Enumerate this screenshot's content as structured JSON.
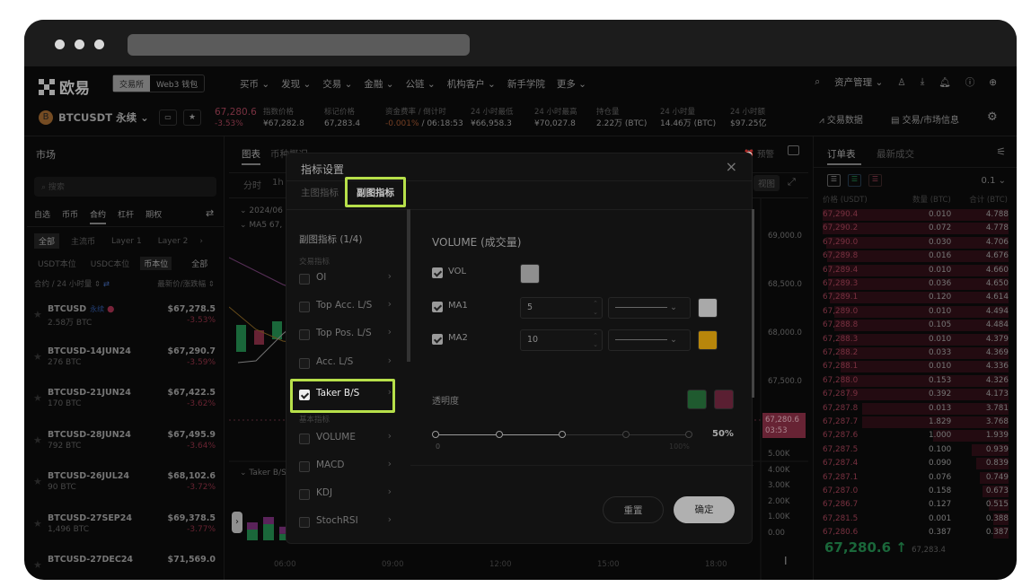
{
  "nav": {
    "brand": "欧易",
    "seg": [
      "交易所",
      "Web3 钱包"
    ],
    "items": [
      "买币",
      "发现",
      "交易",
      "金融",
      "公链",
      "机构客户",
      "新手学院",
      "更多"
    ],
    "asset": "资产管理"
  },
  "ticker": {
    "pair": "BTCUSDT 永续",
    "price": "67,280.6",
    "change": "-3.53%",
    "stats": [
      {
        "l": "指数价格",
        "v": "¥67,282.8"
      },
      {
        "l": "标记价格",
        "v": "67,283.4"
      },
      {
        "l": "资金费率 / 倒计时",
        "v1": "-0.001%",
        "v2": " / 06:18:53"
      },
      {
        "l": "24 小时最低",
        "v": "¥66,958.3"
      },
      {
        "l": "24 小时最高",
        "v": "¥70,027.8"
      },
      {
        "l": "持仓量",
        "v": "2.22万 (BTC)"
      },
      {
        "l": "24 小时量",
        "v": "14.46万 (BTC)"
      },
      {
        "l": "24 小时额",
        "v": "$97.25亿"
      }
    ],
    "trade_data": "交易数据",
    "market_info": "交易/市场信息"
  },
  "market": {
    "title": "市场",
    "search_placeholder": "搜索",
    "tabs": [
      "自选",
      "币币",
      "合约",
      "杠杆",
      "期权"
    ],
    "subtabs": [
      "全部",
      "主流币",
      "Layer 1",
      "Layer 2"
    ],
    "units": [
      "USDT本位",
      "USDC本位",
      "币本位",
      "全部"
    ],
    "col_left": "合约 / 24 小时量",
    "col_right": "最新价/涨跌幅",
    "items": [
      {
        "name": "BTCUSD",
        "tag": "永续",
        "vol": "2.58万 BTC",
        "price": "$67,278.5",
        "chg": "-3.53%"
      },
      {
        "name": "BTCUSD-14JUN24",
        "vol": "276 BTC",
        "price": "$67,290.7",
        "chg": "-3.59%"
      },
      {
        "name": "BTCUSD-21JUN24",
        "vol": "170 BTC",
        "price": "$67,422.5",
        "chg": "-3.62%"
      },
      {
        "name": "BTCUSD-28JUN24",
        "vol": "792 BTC",
        "price": "$67,495.9",
        "chg": "-3.64%"
      },
      {
        "name": "BTCUSD-26JUL24",
        "vol": "90 BTC",
        "price": "$68,102.6",
        "chg": "-3.72%"
      },
      {
        "name": "BTCUSD-27SEP24",
        "vol": "1,496 BTC",
        "price": "$69,378.5",
        "chg": "-3.77%"
      },
      {
        "name": "BTCUSD-27DEC24",
        "vol": "",
        "price": "$71,569.0",
        "chg": ""
      }
    ]
  },
  "chart": {
    "tabs": [
      "图表",
      "币种概况"
    ],
    "intervals": [
      "分时",
      "1h"
    ],
    "date": "2024/06",
    "ma": "MA5 67,",
    "sub": "Taker B/S",
    "alert": "预警",
    "view": "视图",
    "price_axis": [
      "69,000.0",
      "68,500.0",
      "68,000.0",
      "67,500.0",
      "67,000.0"
    ],
    "last_price": "67,280.6",
    "countdown": "03:53",
    "vol_axis": [
      "5.00K",
      "4.00K",
      "3.00K",
      "2.00K",
      "1.00K",
      "0.00"
    ],
    "time_axis": [
      "06:00",
      "09:00",
      "12:00",
      "15:00",
      "18:00"
    ]
  },
  "modal": {
    "title": "指标设置",
    "tabs": [
      "主图指标",
      "副图指标"
    ],
    "list_title": "副图指标 (1/4)",
    "group1": "交易指标",
    "group2": "基本指标",
    "items": [
      {
        "label": "OI",
        "checked": false
      },
      {
        "label": "Top Acc. L/S",
        "checked": false
      },
      {
        "label": "Top Pos. L/S",
        "checked": false
      },
      {
        "label": "Acc. L/S",
        "checked": false
      },
      {
        "label": "Taker B/S",
        "checked": true
      },
      {
        "label": "VOLUME",
        "checked": false
      },
      {
        "label": "MACD",
        "checked": false
      },
      {
        "label": "KDJ",
        "checked": false
      },
      {
        "label": "StochRSI",
        "checked": false
      }
    ],
    "detail_title": "VOLUME (成交量)",
    "rows": [
      {
        "label": "VOL",
        "color": "#8f8f8f"
      },
      {
        "label": "MA1",
        "value": "5",
        "color": "#a9a9a9"
      },
      {
        "label": "MA2",
        "value": "10",
        "color": "#b8860b"
      }
    ],
    "opacity_label": "透明度",
    "opacity_colors": [
      "#1f5a2f",
      "#5a1f32"
    ],
    "opacity": 50,
    "opacity_value": "50%",
    "slider_min": "0",
    "slider_max": "100%",
    "reset": "重置",
    "confirm": "确定"
  },
  "book": {
    "tabs": [
      "订单表",
      "最新成交"
    ],
    "precision": "0.1",
    "cols": [
      "价格 (USDT)",
      "数量 (BTC)",
      "合计 (BTC)"
    ],
    "asks": [
      [
        "67,290.4",
        "0.010",
        "4.788"
      ],
      [
        "67,290.2",
        "0.072",
        "4.778"
      ],
      [
        "67,290.0",
        "0.030",
        "4.706"
      ],
      [
        "67,289.8",
        "0.016",
        "4.676"
      ],
      [
        "67,289.4",
        "0.010",
        "4.660"
      ],
      [
        "67,289.3",
        "0.036",
        "4.650"
      ],
      [
        "67,289.1",
        "0.120",
        "4.614"
      ],
      [
        "67,289.0",
        "0.010",
        "4.494"
      ],
      [
        "67,288.8",
        "0.105",
        "4.484"
      ],
      [
        "67,288.3",
        "0.010",
        "4.379"
      ],
      [
        "67,288.2",
        "0.033",
        "4.369"
      ],
      [
        "67,288.1",
        "0.010",
        "4.336"
      ],
      [
        "67,288.0",
        "0.153",
        "4.326"
      ],
      [
        "67,287.9",
        "0.392",
        "4.173"
      ],
      [
        "67,287.8",
        "0.013",
        "3.781"
      ],
      [
        "67,287.7",
        "1.829",
        "3.768"
      ],
      [
        "67,287.6",
        "1.000",
        "1.939"
      ],
      [
        "67,287.5",
        "0.100",
        "0.939"
      ],
      [
        "67,287.4",
        "0.090",
        "0.839"
      ],
      [
        "67,287.1",
        "0.076",
        "0.749"
      ],
      [
        "67,287.0",
        "0.158",
        "0.673"
      ],
      [
        "67,286.7",
        "0.127",
        "0.515"
      ],
      [
        "67,281.5",
        "0.001",
        "0.388"
      ],
      [
        "67,280.6",
        "0.387",
        "0.387"
      ]
    ],
    "last": "67,280.6",
    "last_arrow": "↑",
    "mark": "67,283.4"
  }
}
